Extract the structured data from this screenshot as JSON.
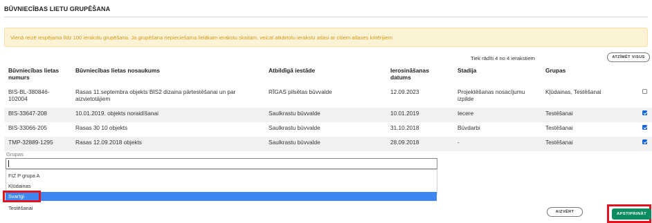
{
  "dialog": {
    "title": "BŪVNIECĪBAS LIETU GRUPĒŠANA",
    "notice": "Vienā reizē iespējama līdz 100 ierakstu grupēšana. Ja grupēšana nepieciešama lielākam ierakstu skaitam, veicat atkārtotu ierakstu atlasi ar citiem atlases kritērijiem."
  },
  "records": {
    "shown_text": "Tiek rādīti 4 no 4 ierakstiem",
    "show_all_label": "ATZĪMĒT VISUS"
  },
  "table": {
    "columns": [
      "Būvniecības lietas numurs",
      "Būvniecības lietas nosaukums",
      "Atbildīgā iestāde",
      "Ierosināšanas datums",
      "Stadija",
      "Grupas"
    ],
    "rows": [
      {
        "number": "BIS-BL-380846-102004",
        "name": "Rasas 11.septembra objekts BIS2 dizaina pārtestēšanai un par aizvietotājiem",
        "authority": "RĪGAS pilsētas būvvalde",
        "date": "12.09.2023",
        "stage": "Projektēšanas nosacījumu izpilde",
        "groups": "Kļūdainas, Testēšanai",
        "checked": false
      },
      {
        "number": "BIS-33647-208",
        "name": "10.01.2019. objekts noraidīšanai",
        "authority": "Saulkrastu būvvalde",
        "date": "10.01.2019",
        "stage": "Iecere",
        "groups": "Testēšanai",
        "checked": true
      },
      {
        "number": "BIS-33066-205",
        "name": "Rasas 30 10 objekts",
        "authority": "Saulkrastu būvvalde",
        "date": "31.10.2018",
        "stage": "Būvdarbi",
        "groups": "Testēšanai",
        "checked": true
      },
      {
        "number": "TMP-32889-1295",
        "name": "Rasas 12.09.2018 objekts",
        "authority": "Saulkrastu būvvalde",
        "date": "28.09.2018",
        "stage": "-",
        "groups": "Testēšanai",
        "checked": true
      }
    ]
  },
  "groups_field": {
    "label": "Grupas",
    "value": "",
    "options": [
      "FIZ P grupa A",
      "Kļūdainas",
      "Svarīgi",
      "Testēšanai"
    ],
    "highlighted": "Svarīgi"
  },
  "footer": {
    "close_label": "AIZVĒRT",
    "confirm_label": "APSTIPRINĀT"
  },
  "colors": {
    "notice_bg": "#fcf3d7",
    "notice_text": "#d59a14",
    "checkbox_checked": "#1565d8",
    "option_selected": "#3f87f0",
    "confirm_bg": "#0d8c5f",
    "highlight": "#e0141e"
  }
}
